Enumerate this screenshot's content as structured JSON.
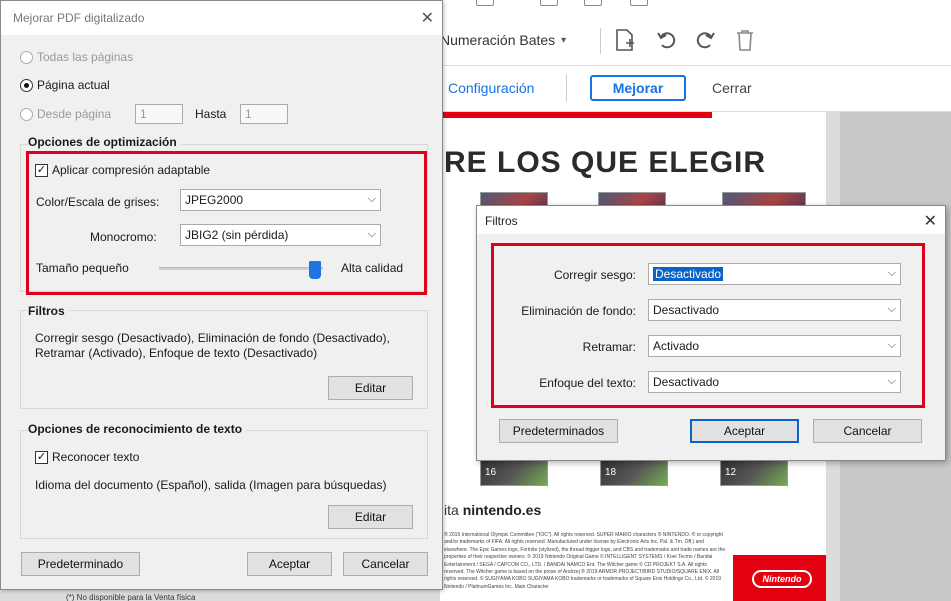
{
  "background_app": {
    "toolbar": {
      "bates_label": "Numeración Bates",
      "bates_caret": "▾"
    },
    "secondary_bar": {
      "config_link": "Configuración",
      "mejorar_button": "Mejorar",
      "cerrar_link": "Cerrar"
    },
    "document": {
      "title": "RE LOS QUE ELEGIR",
      "thumb_labels": [
        "16",
        "18",
        "12"
      ],
      "visit_prefix": "ita ",
      "visit_site": "nintendo.es",
      "fine_print": "® 2019 International Olympic Committee (\"IOC\"). All rights reserved. SUPER MARIO characters ® NINTENDO. ® or copyright and/or trademarks of FIFA. All rights reserved. Manufactured under license by Electronic Arts Inc. Pal. & Tm. Off.) and elsewhere. The Epic Games logo, Fortnite (stylized), the thread trigger logo, and CBS and trademarks and trade names are the properties of their respective owners. © 2019 Nintendo Original Game © INTELLIGENT SYSTEMS / Koei Tecmo / Bandai Entertainment / SEGA / CAPCOM CO., LTD. / BANDAI NAMCO Ent. The Witcher game © CD PROJEKT S.A. All rights reserved. The Witcher game is based on the prose of Andrzej ® 2019 ARMOR PROJECT/BIRD STUDIO/SQUARE ENIX. All rights reserved. © SUGIYAMA KOBO SUGIYAMA KOBO trademarks or trademarks of Square Enix Holdings Co., Ltd. © 2019 Nintendo / PlatinumGames Inc. Main Character",
      "nintendo_logo": "Nintendo",
      "footnote": "(*) No disponible para la Venta física"
    }
  },
  "main_dialog": {
    "title": "Mejorar PDF digitalizado",
    "close_glyph": "✕",
    "page_range": {
      "all_pages": "Todas las páginas",
      "current_page": "Página actual",
      "from_page": "Desde página",
      "from_value": "1",
      "to_label": "Hasta",
      "to_value": "1"
    },
    "optimization": {
      "section_title": "Opciones de optimización",
      "adaptive_compression": "Aplicar compresión adaptable",
      "color_label": "Color/Escala de grises:",
      "color_value": "JPEG2000",
      "mono_label": "Monocromo:",
      "mono_value": "JBIG2 (sin pérdida)",
      "slider_min_label": "Tamaño pequeño",
      "slider_max_label": "Alta calidad",
      "slider_level": 0.95
    },
    "filters": {
      "section_title": "Filtros",
      "summary_line1": "Corregir sesgo (Desactivado), Eliminación de fondo (Desactivado),",
      "summary_line2": "Retramar (Activado), Enfoque de texto (Desactivado)",
      "edit_button": "Editar"
    },
    "ocr": {
      "section_title": "Opciones de reconocimiento de texto",
      "recognize_text": "Reconocer texto",
      "summary": "Idioma del documento (Español), salida (Imagen para búsquedas)",
      "edit_button": "Editar"
    },
    "buttons": {
      "defaults": "Predeterminado",
      "accept": "Aceptar",
      "cancel": "Cancelar"
    }
  },
  "filters_dialog": {
    "title": "Filtros",
    "close_glyph": "✕",
    "rows": [
      {
        "label": "Corregir sesgo:",
        "value": "Desactivado"
      },
      {
        "label": "Eliminación de fondo:",
        "value": "Desactivado"
      },
      {
        "label": "Retramar:",
        "value": "Activado"
      },
      {
        "label": "Enfoque del texto:",
        "value": "Desactivado"
      }
    ],
    "buttons": {
      "defaults": "Predeterminados",
      "accept": "Aceptar",
      "cancel": "Cancelar"
    }
  },
  "colors": {
    "highlight_red": "#e0001b",
    "accent_blue": "#1473e6",
    "selection_blue": "#0a64c8",
    "nintendo_red": "#e4000f"
  },
  "icons": {
    "checked": "✓",
    "dropdown": "⌵"
  }
}
